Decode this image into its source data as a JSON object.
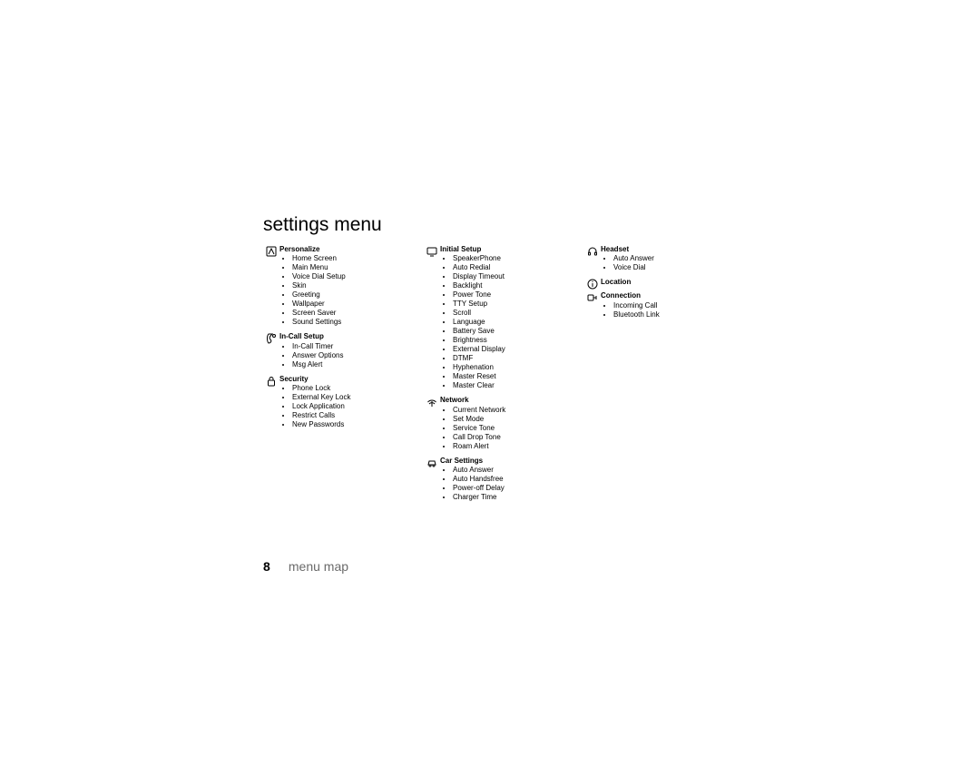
{
  "heading": "settings menu",
  "footer": {
    "page": "8",
    "label": "menu map"
  },
  "columns": [
    [
      {
        "icon": "palette",
        "title": "Personalize",
        "items": [
          "Home Screen",
          "Main Menu",
          "Voice Dial Setup",
          "Skin",
          "Greeting",
          "Wallpaper",
          "Screen Saver",
          "Sound Settings"
        ]
      },
      {
        "icon": "phone-gear",
        "title": "In-Call Setup",
        "items": [
          "In-Call Timer",
          "Answer Options",
          "Msg Alert"
        ]
      },
      {
        "icon": "lock",
        "title": "Security",
        "items": [
          "Phone Lock",
          "External Key Lock",
          "Lock Application",
          "Restrict Calls",
          "New Passwords"
        ]
      }
    ],
    [
      {
        "icon": "display",
        "title": "Initial Setup",
        "items": [
          "SpeakerPhone",
          "Auto Redial",
          "Display Timeout",
          "Backlight",
          "Power Tone",
          "TTY Setup",
          "Scroll",
          "Language",
          "Battery Save",
          "Brightness",
          "External Display",
          "DTMF",
          "Hyphenation",
          "Master Reset",
          "Master Clear"
        ]
      },
      {
        "icon": "network",
        "title": "Network",
        "items": [
          "Current Network",
          "Set Mode",
          "Service Tone",
          "Call Drop Tone",
          "Roam Alert"
        ]
      },
      {
        "icon": "car",
        "title": "Car Settings",
        "items": [
          "Auto Answer",
          "Auto Handsfree",
          "Power-off Delay",
          "Charger Time"
        ]
      }
    ],
    [
      {
        "icon": "headset",
        "title": "Headset",
        "items": [
          "Auto Answer",
          "Voice Dial"
        ]
      },
      {
        "icon": "info",
        "title": "Location",
        "items": []
      },
      {
        "icon": "connection",
        "title": "Connection",
        "items": [
          "Incoming Call",
          "Bluetooth Link"
        ]
      }
    ]
  ]
}
